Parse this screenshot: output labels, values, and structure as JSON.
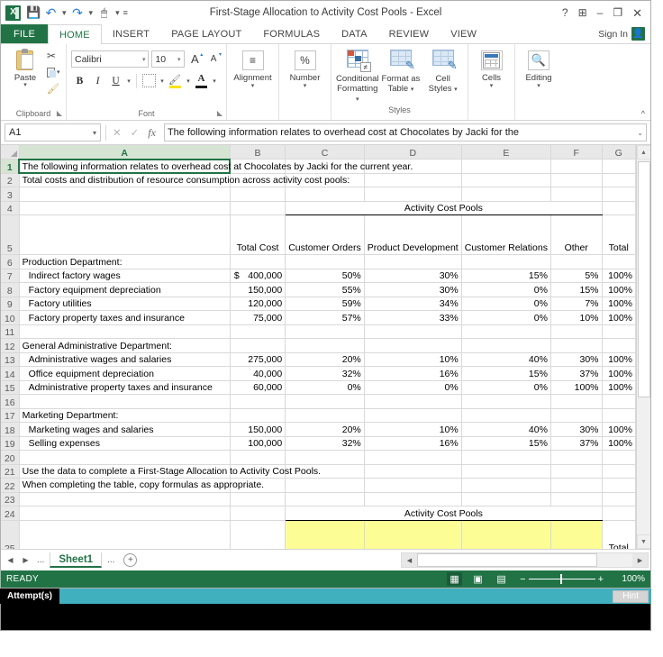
{
  "window": {
    "title": "First-Stage Allocation to Activity Cost Pools - Excel",
    "help": "?",
    "ribbon_display": "➕",
    "minimize": "–",
    "restore": "❐",
    "close": "✕",
    "app_icon": "excel-logo"
  },
  "quick_access": {
    "save": "save-icon",
    "undo": "undo-icon",
    "redo": "redo-icon",
    "touch": "touch-mode-icon",
    "customize": "≡"
  },
  "tabs": {
    "file": "FILE",
    "items": [
      "HOME",
      "INSERT",
      "PAGE LAYOUT",
      "FORMULAS",
      "DATA",
      "REVIEW",
      "VIEW"
    ],
    "active": "HOME",
    "sign_in": "Sign In"
  },
  "ribbon": {
    "clipboard": {
      "group_label": "Clipboard",
      "paste": "Paste",
      "cut": "cut-icon",
      "copy": "copy-icon",
      "format_painter": "format-painter-icon"
    },
    "font": {
      "group_label": "Font",
      "font_name": "Calibri",
      "font_size": "10",
      "grow_font": "A",
      "shrink_font": "A",
      "bold": "B",
      "italic": "I",
      "underline": "U",
      "borders": "borders-icon",
      "fill_color": "fill-color-icon",
      "font_color": "A"
    },
    "alignment": {
      "label": "Alignment",
      "icon": "≡"
    },
    "number": {
      "label": "Number",
      "icon": "%"
    },
    "styles": {
      "group_label": "Styles",
      "conditional_formatting": "Conditional Formatting",
      "format_as_table": "Format as Table",
      "cell_styles": "Cell Styles"
    },
    "cells": {
      "label": "Cells"
    },
    "editing": {
      "label": "Editing"
    },
    "collapse": "^"
  },
  "formula_bar": {
    "name_box": "A1",
    "cancel": "✕",
    "enter": "✓",
    "insert_function": "fx",
    "value": "The following information relates to overhead cost at Chocolates by Jacki for the",
    "expand": "⌄"
  },
  "grid": {
    "columns": [
      "A",
      "B",
      "C",
      "D",
      "E",
      "F",
      "G"
    ],
    "selected_column": "A",
    "selected_row": "1",
    "selected_cell": "A1",
    "rows": [
      {
        "n": "1",
        "a": "The following information relates to overhead cost at Chocolates by Jacki for the current year.",
        "spill": true
      },
      {
        "n": "2",
        "a": "Total costs and distribution of resource consumption across activity cost pools:",
        "spill": true
      },
      {
        "n": "3",
        "a": ""
      },
      {
        "n": "4",
        "a": "",
        "group_header": "Activity Cost Pools"
      },
      {
        "n": "5",
        "a": "",
        "b": "Total Cost",
        "c": "Customer Orders",
        "d": "Product Development",
        "e": "Customer Relations",
        "f": "Other",
        "g": "Total",
        "header": true
      },
      {
        "n": "6",
        "a": "Production Department:"
      },
      {
        "n": "7",
        "a": "Indirect factory wages",
        "indent": true,
        "currency": "$",
        "b": "400,000",
        "c": "50%",
        "d": "30%",
        "e": "15%",
        "f": "5%",
        "g": "100%"
      },
      {
        "n": "8",
        "a": "Factory equipment depreciation",
        "indent": true,
        "b": "150,000",
        "c": "55%",
        "d": "30%",
        "e": "0%",
        "f": "15%",
        "g": "100%"
      },
      {
        "n": "9",
        "a": "Factory utilities",
        "indent": true,
        "b": "120,000",
        "c": "59%",
        "d": "34%",
        "e": "0%",
        "f": "7%",
        "g": "100%"
      },
      {
        "n": "10",
        "a": "Factory property taxes and insurance",
        "indent": true,
        "b": "75,000",
        "c": "57%",
        "d": "33%",
        "e": "0%",
        "f": "10%",
        "g": "100%"
      },
      {
        "n": "11",
        "a": ""
      },
      {
        "n": "12",
        "a": "General Administrative Department:"
      },
      {
        "n": "13",
        "a": "Administrative wages and salaries",
        "indent": true,
        "b": "275,000",
        "c": "20%",
        "d": "10%",
        "e": "40%",
        "f": "30%",
        "g": "100%"
      },
      {
        "n": "14",
        "a": "Office equipment depreciation",
        "indent": true,
        "b": "40,000",
        "c": "32%",
        "d": "16%",
        "e": "15%",
        "f": "37%",
        "g": "100%"
      },
      {
        "n": "15",
        "a": "Administrative property taxes and insurance",
        "indent": true,
        "b": "60,000",
        "c": "0%",
        "d": "0%",
        "e": "0%",
        "f": "100%",
        "g": "100%"
      },
      {
        "n": "16",
        "a": ""
      },
      {
        "n": "17",
        "a": "Marketing Department:"
      },
      {
        "n": "18",
        "a": "Marketing wages and salaries",
        "indent": true,
        "b": "150,000",
        "c": "20%",
        "d": "10%",
        "e": "40%",
        "f": "30%",
        "g": "100%"
      },
      {
        "n": "19",
        "a": "Selling expenses",
        "indent": true,
        "b": "100,000",
        "c": "32%",
        "d": "16%",
        "e": "15%",
        "f": "37%",
        "g": "100%"
      },
      {
        "n": "20",
        "a": ""
      },
      {
        "n": "21",
        "a": "Use the data to complete a First-Stage Allocation to Activity Cost Pools.",
        "spill": true
      },
      {
        "n": "22",
        "a": "When completing the table, copy formulas as appropriate.",
        "spill": true
      },
      {
        "n": "23",
        "a": ""
      },
      {
        "n": "24",
        "a": "",
        "group_header": "Activity Cost Pools"
      },
      {
        "n": "25",
        "a": "",
        "yellow": true,
        "g_partial": "Total"
      }
    ],
    "scroll_up": "▲",
    "scroll_down": "▼"
  },
  "sheet_tabs": {
    "first": "◀",
    "prev": "◀",
    "next": "▶",
    "last": "▶",
    "left_dots": "...",
    "right_dots": "...",
    "sheets": [
      "Sheet1"
    ],
    "active_sheet": "Sheet1",
    "new_sheet": "⊕",
    "hscroll_left": "◀",
    "hscroll_right": "▶"
  },
  "status_bar": {
    "mode": "READY",
    "view_normal": "normal-view-icon",
    "view_page_layout": "page-layout-view-icon",
    "view_page_break": "page-break-view-icon",
    "zoom_out": "−",
    "zoom_in": "+",
    "zoom_level": "100%"
  },
  "attempt_bar": {
    "label": "Attempt(s)",
    "hint": "Hint"
  },
  "colors": {
    "excel_green": "#217346",
    "tab_active_text": "#217346",
    "highlight_yellow": "#fdfd96",
    "attempt_teal": "#40b0bf",
    "attempt_label_bg": "#000000"
  }
}
